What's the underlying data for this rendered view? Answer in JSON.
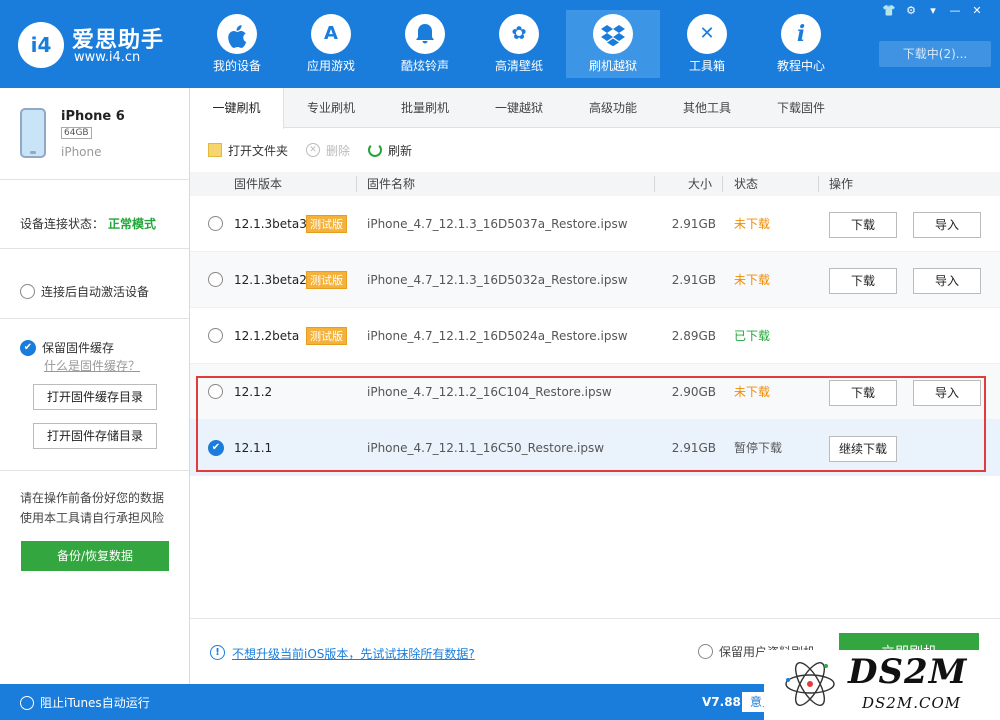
{
  "app": {
    "logo_mark": "i4",
    "name": "爱思助手",
    "url": "www.i4.cn"
  },
  "nav": [
    {
      "label": "我的设备",
      "icon": "apple-icon",
      "glyph": ""
    },
    {
      "label": "应用游戏",
      "icon": "app-store-icon",
      "glyph": "A"
    },
    {
      "label": "酷炫铃声",
      "icon": "bell-icon",
      "glyph": "♪"
    },
    {
      "label": "高清壁纸",
      "icon": "flower-icon",
      "glyph": "✿"
    },
    {
      "label": "刷机越狱",
      "icon": "dropbox-icon",
      "glyph": "◈"
    },
    {
      "label": "工具箱",
      "icon": "tools-icon",
      "glyph": "✕"
    },
    {
      "label": "教程中心",
      "icon": "info-icon",
      "glyph": "i"
    }
  ],
  "window": {
    "download_button": "下载中(2)..."
  },
  "device": {
    "name": "iPhone 6",
    "capacity": "64GB",
    "type": "iPhone",
    "status_label": "设备连接状态：",
    "status_value": "正常模式"
  },
  "sidebar": {
    "auto_activate": "连接后自动激活设备",
    "keep_cache": "保留固件缓存",
    "what_is_cache": "什么是固件缓存？",
    "open_cache_dir": "打开固件缓存目录",
    "open_store_dir": "打开固件存储目录",
    "warning_line1": "请在操作前备份好您的数据",
    "warning_line2": "使用本工具请自行承担风险",
    "backup_button": "备份/恢复数据"
  },
  "tabs": [
    "一键刷机",
    "专业刷机",
    "批量刷机",
    "一键越狱",
    "高级功能",
    "其他工具",
    "下载固件"
  ],
  "toolbar": {
    "open_folder": "打开文件夹",
    "delete": "删除",
    "refresh": "刷新"
  },
  "table": {
    "headers": {
      "version": "固件版本",
      "name": "固件名称",
      "size": "大小",
      "status": "状态",
      "action": "操作"
    },
    "beta_tag": "测试版",
    "rows": [
      {
        "version": "12.1.3beta3",
        "beta": true,
        "file": "iPhone_4.7_12.1.3_16D5037a_Restore.ipsw",
        "size": "2.91GB",
        "status": "未下载",
        "btn1": "下载",
        "btn2": "导入"
      },
      {
        "version": "12.1.3beta2",
        "beta": true,
        "file": "iPhone_4.7_12.1.3_16D5032a_Restore.ipsw",
        "size": "2.91GB",
        "status": "未下载",
        "btn1": "下载",
        "btn2": "导入"
      },
      {
        "version": "12.1.2beta",
        "beta": true,
        "file": "iPhone_4.7_12.1.2_16D5024a_Restore.ipsw",
        "size": "2.89GB",
        "status": "已下载"
      },
      {
        "version": "12.1.2",
        "beta": false,
        "file": "iPhone_4.7_12.1.2_16C104_Restore.ipsw",
        "size": "2.90GB",
        "status": "未下载",
        "btn1": "下载",
        "btn2": "导入"
      },
      {
        "version": "12.1.1",
        "beta": false,
        "file": "iPhone_4.7_12.1.1_16C50_Restore.ipsw",
        "size": "2.91GB",
        "status": "暂停下载",
        "btn1": "继续下载"
      }
    ]
  },
  "bottom": {
    "info_link": "不想升级当前iOS版本，先试试抹除所有数据?",
    "keep_user_data": "保留用户资料刷机",
    "flash_button": "立即刷机"
  },
  "statusbar": {
    "itunes": "阻止iTunes自动运行",
    "version": "V7.88",
    "feedback": "意见反馈"
  },
  "watermark": {
    "big": "DS2M",
    "small": "DS2M.COM"
  }
}
